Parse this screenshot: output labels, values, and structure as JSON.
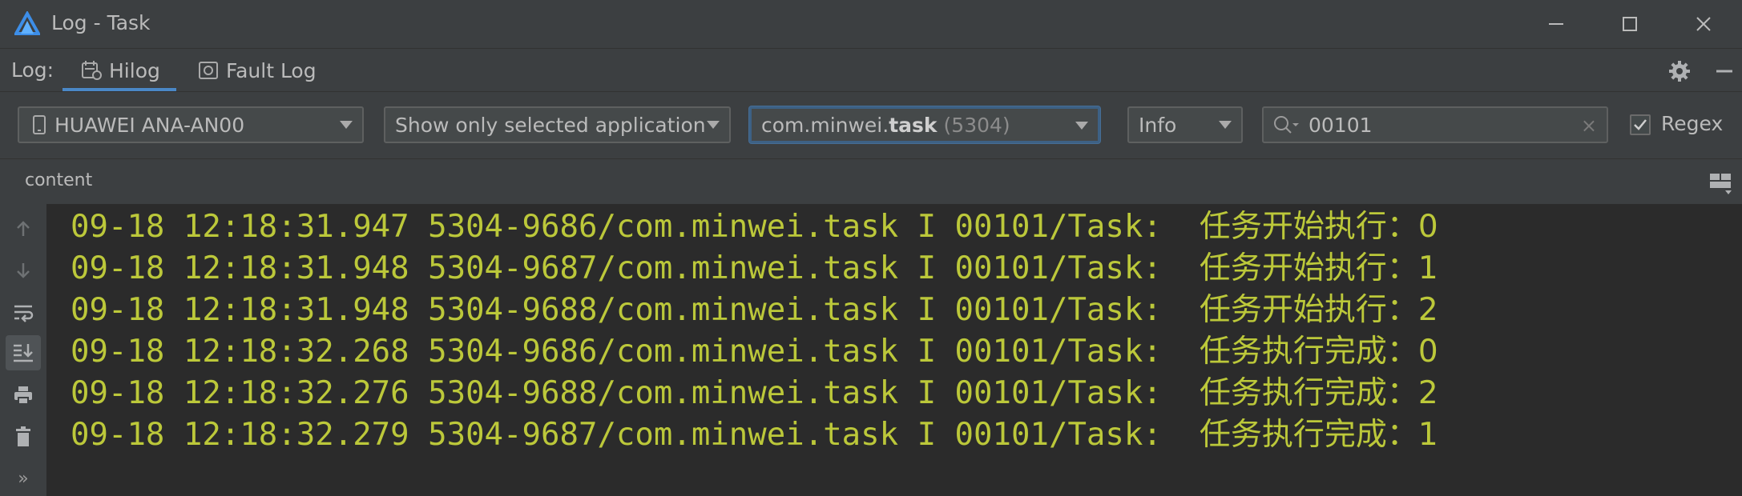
{
  "window": {
    "title": "Log - Task",
    "icons": {
      "logo": "deveco-logo-icon",
      "minimize": "minimize-icon",
      "maximize": "maximize-icon",
      "close": "close-icon"
    }
  },
  "tabs": {
    "prefix": "Log:",
    "items": [
      {
        "label": "Hilog",
        "icon": "hilog-icon",
        "active": true
      },
      {
        "label": "Fault Log",
        "icon": "fault-log-icon",
        "active": false
      }
    ],
    "settings_icon": "gear-icon",
    "hide_icon": "hide-panel-icon"
  },
  "filters": {
    "device": "HUAWEI ANA-AN00",
    "scope": "Show only selected application",
    "app_prefix": "com.minwei.",
    "app_bold": "task",
    "app_pid": "(5304)",
    "level": "Info",
    "search_value": "00101",
    "search_clear": "×",
    "regex_label": "Regex",
    "regex_checked": true
  },
  "content_header": {
    "label": "content"
  },
  "side_actions": [
    "up-arrow-icon",
    "down-arrow-icon",
    "soft-wrap-icon",
    "scroll-to-end-icon",
    "print-icon",
    "trash-icon",
    "more-icon"
  ],
  "side_more": "»",
  "log": {
    "lines": [
      {
        "prefix": "09-18 12:18:31.947 5304-9686/com.minwei.task I 00101/Task:  ",
        "message": "任务开始执行：0"
      },
      {
        "prefix": "09-18 12:18:31.948 5304-9687/com.minwei.task I 00101/Task:  ",
        "message": "任务开始执行：1"
      },
      {
        "prefix": "09-18 12:18:31.948 5304-9688/com.minwei.task I 00101/Task:  ",
        "message": "任务开始执行：2"
      },
      {
        "prefix": "09-18 12:18:32.268 5304-9686/com.minwei.task I 00101/Task:  ",
        "message": "任务执行完成：0"
      },
      {
        "prefix": "09-18 12:18:32.276 5304-9688/com.minwei.task I 00101/Task:  ",
        "message": "任务执行完成：2"
      },
      {
        "prefix": "09-18 12:18:32.279 5304-9687/com.minwei.task I 00101/Task:  ",
        "message": "任务执行完成：1"
      }
    ]
  },
  "colors": {
    "log_text": "#bcc83a",
    "accent": "#4a88c7",
    "panel": "#3c3f41",
    "editor": "#2b2b2b"
  }
}
